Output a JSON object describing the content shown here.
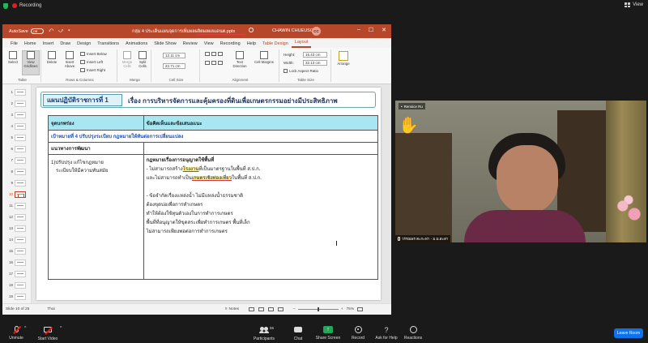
{
  "zoom_top": {
    "recording_label": "Recording",
    "view_label": "View"
  },
  "ppt": {
    "autosave_label": "AutoSave",
    "autosave_state": "Off",
    "quick_access": "⤺ ⤻ ▾",
    "filename": "กลุ่ม 4 ประเด็นแผนจุดการเพิ่มผลผลิตผลผลแดนต.pptx",
    "username": "CHAWIN CHUEUSOL",
    "user_initials": "CC",
    "window_controls": [
      "–",
      "☐",
      "✕"
    ],
    "tabs": [
      "File",
      "Home",
      "Insert",
      "Draw",
      "Design",
      "Transitions",
      "Animations",
      "Slide Show",
      "Review",
      "View",
      "Recording",
      "Help",
      "Table Design",
      "Layout"
    ],
    "ribbon": {
      "table_group": "Table",
      "select": "Select",
      "view_gridlines": "View Gridlines",
      "rows_group": "Rows & Columns",
      "delete": "Delete",
      "insert_above": "Insert Above",
      "insert_below": "Insert Below",
      "insert_left": "Insert Left",
      "insert_right": "Insert Right",
      "merge_group": "Merge",
      "merge_cells": "Merge Cells",
      "split_cells": "Split Cells",
      "cellsize_group": "Cell Size",
      "height_value": "12.11 cm",
      "width_value": "22.71 cm",
      "alignment_group": "Alignment",
      "text_direction": "Text Direction",
      "cell_margins": "Cell Margins",
      "tablesize_group": "Table Size",
      "height_label": "Height:",
      "table_height": "16.43 cm",
      "width_label": "Width:",
      "table_width": "32.13 cm",
      "lock_aspect": "Lock Aspect Ratio",
      "arrange": "Arrange"
    },
    "thumbnails": [
      "1",
      "2",
      "3",
      "4",
      "5",
      "6",
      "7",
      "8",
      "9",
      "10",
      "11",
      "12",
      "13",
      "14",
      "15",
      "16",
      "17",
      "18",
      "19"
    ],
    "selected_thumb": "10",
    "slide": {
      "badge": "แผนปฏิบัติราชการที่  1",
      "title": "เรื่อง การบริหารจัดการและคุ้มครองที่ดินเพื่อเกษตรกรรมอย่างมีประสิทธิภาพ",
      "col1_header": "จุดบกพร่อง",
      "col2_header": "ข้อคิดเห็นและข้อเสนอแนะ",
      "target": "เป้าหมายที่ 4 ปรับปรุงระเบียบ กฎหมายให้ทันต่อการเปลี่ยนแปลง",
      "approach": "แนวทางการพัฒนา",
      "left_cell": [
        "1)ปรับปรุง แก้ไขกฎหมาย",
        "ระเบียบให้มีความทันสมัย"
      ],
      "right_heading": "กฎหมายเรื่องการอนุญาตใช้พื้นที่",
      "right_line1_a": "- ไม่สามารถสร้าง",
      "right_line1_hl": "โรงงาน",
      "right_line1_b": "ที่เป็นมาตรฐานในพื้นที่ ส.ป.ก.",
      "right_line2_a": "และไม่สามารถทำเป็น",
      "right_line2_hl": "เกษตรเชิงท่องเที่ยว",
      "right_line2_b": "ในพื้นที่ ส.ป.ก.",
      "right_line3": "- ข้อจำกัดเรื่องแหล่งน้ำ ไม่มีแหล่งน้ำธรรมชาติ",
      "right_line4": "ต้องขุดบ่อเพื่อการทำเกษตร",
      "right_line5": "ทำให้ต้องใช้ทุนตัวเองในการทำการเกษตร",
      "right_line6": "พื้นที่ที่อนุญาตให้ขุดสระเพื่อทำการเกษตร พื้นที่เล็ก",
      "right_line7": "ไม่สามารถเพียงพอต่อการทำการเกษตร"
    },
    "status": {
      "slide_of": "Slide 10 of 25",
      "language": "Thai",
      "notes": "Notes",
      "zoom": "75%"
    }
  },
  "video": {
    "raised_name": "Rensice Ru",
    "participant_name": "วรรณพร ตะกะฟา - ม.ม.สะสา"
  },
  "toolbar": {
    "unmute": "Unmute",
    "start_video": "Start Video",
    "participants": "Participants",
    "participants_count": "55",
    "chat": "Chat",
    "share_screen": "Share Screen",
    "record": "Record",
    "ask_for_help": "Ask for Help",
    "reactions": "Reactions",
    "leave": "Leave Room"
  }
}
